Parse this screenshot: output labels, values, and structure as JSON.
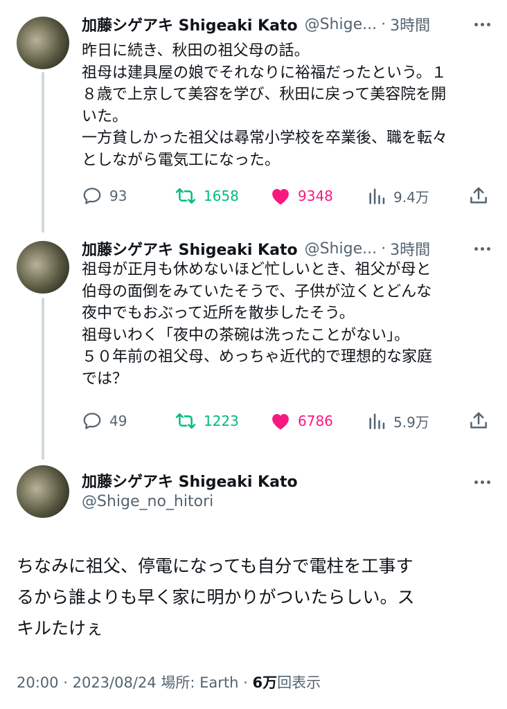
{
  "tweets": [
    {
      "author_name": "加藤シゲアキ Shigeaki Kato",
      "handle": "@Shige...",
      "separator": "·",
      "time": "3時間",
      "lines": [
        "昨日に続き、秋田の祖父母の話。",
        "祖母は建具屋の娘でそれなりに裕福だったという。１",
        "８歳で上京して美容を学び、秋田に戻って美容院を開",
        "いた。",
        "一方貧しかった祖父は尋常小学校を卒業後、職を転々",
        "としながら電気工になった。"
      ],
      "replies": "93",
      "retweets": "1658",
      "likes": "9348",
      "views": "9.4万"
    },
    {
      "author_name": "加藤シゲアキ Shigeaki Kato",
      "handle": "@Shige...",
      "separator": "·",
      "time": "3時間",
      "lines": [
        "祖母が正月も休めないほど忙しいとき、祖父が母と",
        "伯母の面倒をみていたそうで、子供が泣くとどんな",
        "夜中でもおぶって近所を散歩したそう。",
        "祖母いわく「夜中の茶碗は洗ったことがない」。",
        "５０年前の祖父母、めっちゃ近代的で理想的な家庭",
        "では？"
      ],
      "replies": "49",
      "retweets": "1223",
      "likes": "6786",
      "views": "5.9万"
    }
  ],
  "main_tweet": {
    "author_name": "加藤シゲアキ Shigeaki Kato",
    "handle": "@Shige_no_hitori",
    "lines": [
      "ちなみに祖父、停電になっても自分で電柱を工事す",
      "るから誰よりも早く家に明かりがついたらしい。ス",
      "キルたけぇ"
    ],
    "meta": {
      "time": "20:00",
      "date": "2023/08/24",
      "location": "場所: Earth",
      "views_count": "6万",
      "views_label": "回表示",
      "dot": "·"
    }
  },
  "icons": {
    "reply": "reply-bubble-icon",
    "retweet": "retweet-icon",
    "like": "heart-icon",
    "views": "analytics-bars-icon",
    "share": "share-upload-icon",
    "more": "more-dots-icon"
  },
  "colors": {
    "text": "#0f1419",
    "secondary": "#536471",
    "retweet": "#00ba7c",
    "like": "#f91880",
    "thread_line": "#cfd9de"
  }
}
